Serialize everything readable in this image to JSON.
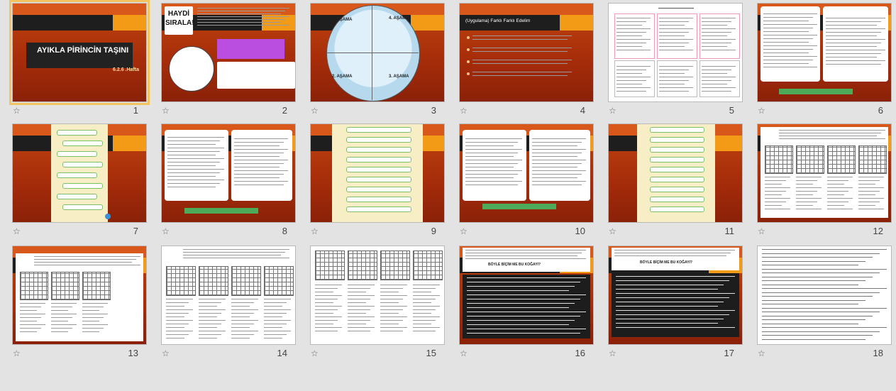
{
  "slides": [
    {
      "number": "1",
      "title": "AYIKLA PİRİNCİN TAŞINI",
      "subtitle": "6.2.6 .Hafta"
    },
    {
      "number": "2",
      "title": "HAYDİ SIRALA!"
    },
    {
      "number": "3",
      "labels": [
        "1. AŞAMA",
        "4. AŞAMA",
        "2. AŞAMA",
        "3. AŞAMA"
      ]
    },
    {
      "number": "4",
      "title": "(Uygulama) Farklı Farklı Edelim"
    },
    {
      "number": "5"
    },
    {
      "number": "6"
    },
    {
      "number": "7"
    },
    {
      "number": "8"
    },
    {
      "number": "9"
    },
    {
      "number": "10"
    },
    {
      "number": "11"
    },
    {
      "number": "12"
    },
    {
      "number": "13"
    },
    {
      "number": "14"
    },
    {
      "number": "15"
    },
    {
      "number": "16",
      "title": "BÖYLE BİÇİM ME BU KOĞAYI?"
    },
    {
      "number": "17",
      "title": "BÖYLE BİÇİM ME BU KOĞAYI?"
    },
    {
      "number": "18"
    }
  ],
  "icons": {
    "star": "star-icon"
  }
}
